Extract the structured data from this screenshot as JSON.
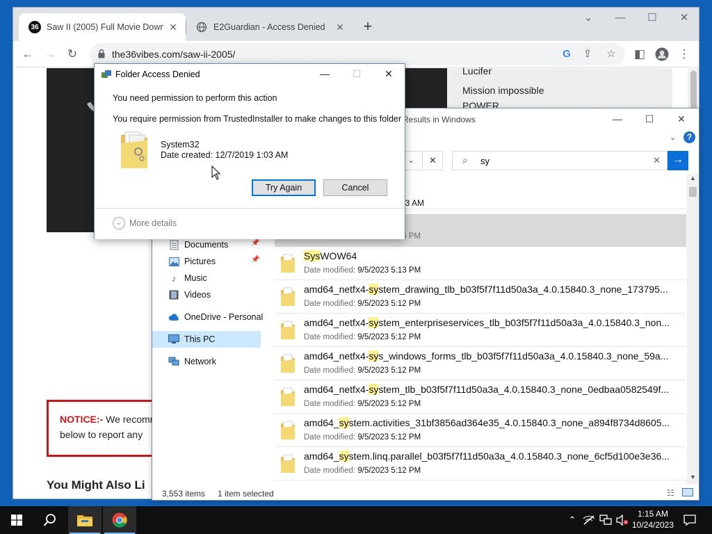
{
  "browser": {
    "tabs": [
      {
        "title": "Saw II (2005) Full Movie Downlo",
        "favicon": "36",
        "active": true
      },
      {
        "title": "E2Guardian - Access Denied",
        "active": false
      }
    ],
    "url": "the36vibes.com/saw-ii-2005/",
    "page": {
      "sidebar_links": [
        "Lucifer",
        "Mission impossible",
        "POWER"
      ],
      "notice_label": "NOTICE:-",
      "notice_line1": " We recomm",
      "notice_line2": "below to report any",
      "also_heading": "You Might Also Li"
    }
  },
  "explorer": {
    "title": "h Results in Windows",
    "search_query": "sy",
    "nav": [
      {
        "label": "Documents",
        "icon": "documents-icon",
        "pinned": true
      },
      {
        "label": "Pictures",
        "icon": "pictures-icon",
        "pinned": true
      },
      {
        "label": "Music",
        "icon": "music-icon",
        "pinned": false
      },
      {
        "label": "Videos",
        "icon": "videos-icon",
        "pinned": false
      },
      {
        "label": "OneDrive - Personal",
        "icon": "onedrive-icon",
        "pinned": false
      },
      {
        "label": "This PC",
        "icon": "this-pc-icon",
        "pinned": false,
        "selected": true
      },
      {
        "label": "Network",
        "icon": "network-icon",
        "pinned": false
      }
    ],
    "partial_row_1_date": "13 AM",
    "partial_row_2_meta": "Date modified: 9/5/2023 5:26 PM",
    "results": [
      {
        "pre": "",
        "hl": "Sys",
        "post": "WOW64",
        "date_label": "Date modified:",
        "date": "9/5/2023 5:13 PM"
      },
      {
        "pre": "amd64_netfx4-",
        "hl": "sy",
        "post": "stem_drawing_tlb_b03f5f7f11d50a3a_4.0.15840.3_none_173795...",
        "date_label": "Date modified:",
        "date": "9/5/2023 5:12 PM"
      },
      {
        "pre": "amd64_netfx4-",
        "hl": "sy",
        "post": "stem_enterpriseservices_tlb_b03f5f7f11d50a3a_4.0.15840.3_non...",
        "date_label": "Date modified:",
        "date": "9/5/2023 5:12 PM"
      },
      {
        "pre": "amd64_netfx4-",
        "hl": "sy",
        "post": "s_windows_forms_tlb_b03f5f7f11d50a3a_4.0.15840.3_none_59a...",
        "date_label": "Date modified:",
        "date": "9/5/2023 5:12 PM"
      },
      {
        "pre": "amd64_netfx4-",
        "hl": "sy",
        "post": "stem_tlb_b03f5f7f11d50a3a_4.0.15840.3_none_0edbaa0582549f...",
        "date_label": "Date modified:",
        "date": "9/5/2023 5:12 PM"
      },
      {
        "pre": "amd64_",
        "hl": "sy",
        "post": "stem.activities_31bf3856ad364e35_4.0.15840.3_none_a894f8734d8605...",
        "date_label": "Date modified:",
        "date": "9/5/2023 5:12 PM"
      },
      {
        "pre": "amd64_",
        "hl": "sy",
        "post": "stem.linq.parallel_b03f5f7f11d50a3a_4.0.15840.3_none_6cf5d100e3e36...",
        "date_label": "Date modified:",
        "date": "9/5/2023 5:12 PM"
      }
    ],
    "status_items": "3,553 items",
    "status_selected": "1 item selected"
  },
  "dialog": {
    "title": "Folder Access Denied",
    "line1": "You need permission to perform this action",
    "line2": "You require permission from TrustedInstaller to make changes to this folder",
    "folder_name": "System32",
    "folder_date": "Date created: 12/7/2019 1:03 AM",
    "try_again": "Try Again",
    "cancel": "Cancel",
    "more_details": "More details"
  },
  "taskbar": {
    "time": "1:15 AM",
    "date": "10/24/2023"
  },
  "colors": {
    "desktop": "#1160b8",
    "accent": "#0078d7",
    "notice_red": "#d51515",
    "highlight": "#fff38f"
  }
}
